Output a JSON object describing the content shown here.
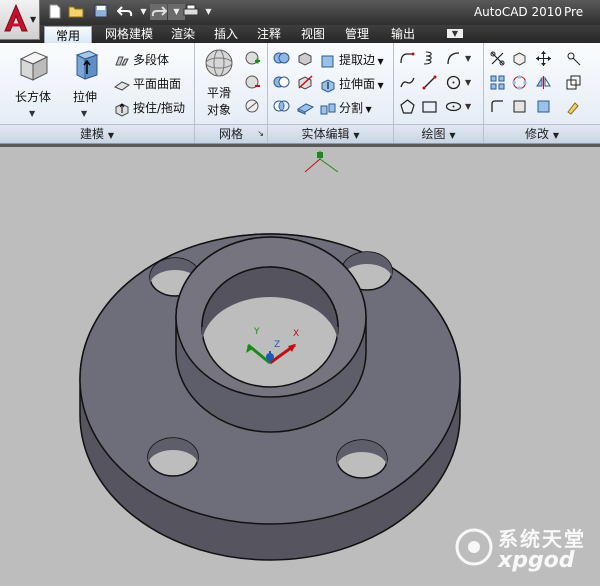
{
  "titlebar": {
    "app_name": "AutoCAD 2010",
    "title_overflow": "Pre"
  },
  "tabs": [
    {
      "label": "常用"
    },
    {
      "label": "网格建模"
    },
    {
      "label": "渲染"
    },
    {
      "label": "插入"
    },
    {
      "label": "注释"
    },
    {
      "label": "视图"
    },
    {
      "label": "管理"
    },
    {
      "label": "输出"
    }
  ],
  "ribbon": {
    "modeling": {
      "title": "建模",
      "box_label": "长方体",
      "extrude_label": "拉伸",
      "polysolid_label": "多段体",
      "planesurf_label": "平面曲面",
      "presspull_label": "按住/拖动"
    },
    "mesh": {
      "title": "网格",
      "smooth_label_1": "平滑",
      "smooth_label_2": "对象"
    },
    "solid_edit": {
      "title": "实体编辑",
      "extract_edges_label": "提取边",
      "extrude_faces_label": "拉伸面",
      "separate_label": "分割"
    },
    "draw": {
      "title": "绘图"
    },
    "modify": {
      "title": "修改"
    }
  },
  "watermark": {
    "line1": "系统天堂",
    "line2": "xpgod"
  },
  "colors": {
    "accent_red": "#c8102e",
    "ribbon_bg": "#e9eff7",
    "viewport_bg": "#bdbdbd",
    "flange_face": "#6e6d7a",
    "flange_side": "#55545f"
  }
}
